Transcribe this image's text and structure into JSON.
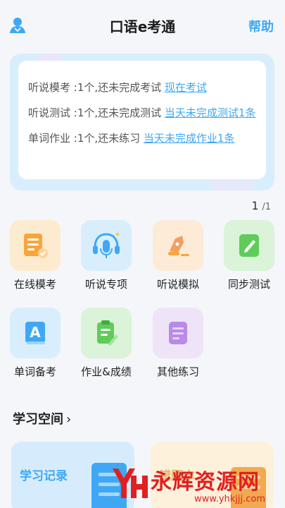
{
  "header": {
    "title": "口语e考通",
    "help_label": "帮助"
  },
  "notices": [
    {
      "text": "听说模考 :1个,还未完成考试 ",
      "link": "现在考试"
    },
    {
      "text": "听说测试 :1个,还未完成测试 ",
      "link": "当天未完成测试1条"
    },
    {
      "text": "单词作业 :1个,还未练习 ",
      "link": "当天未完成作业1条"
    }
  ],
  "pager": {
    "current": "1",
    "total": "/1"
  },
  "tiles": [
    {
      "label": "在线模考",
      "icon": "exam-paper-icon",
      "bg": "#fdebcf"
    },
    {
      "label": "听说专项",
      "icon": "headset-microphone-icon",
      "bg": "#d9eefd"
    },
    {
      "label": "听说模拟",
      "icon": "pen-nib-icon",
      "bg": "#fdebd7"
    },
    {
      "label": "同步测试",
      "icon": "notebook-pencil-icon",
      "bg": "#dbf3d9"
    },
    {
      "label": "单词备考",
      "icon": "letter-a-book-icon",
      "bg": "#d9eefd"
    },
    {
      "label": "作业&成绩",
      "icon": "clipboard-icon",
      "bg": "#dbf3d9"
    },
    {
      "label": "其他练习",
      "icon": "document-lines-icon",
      "bg": "#eee4f8"
    }
  ],
  "section": {
    "title": "学习空间",
    "chevron": "›"
  },
  "cards": [
    {
      "title": "学习记录"
    },
    {
      "title": "错题本"
    }
  ],
  "watermark": {
    "text": "永辉资源网",
    "url": "www.yhkjjj.com"
  }
}
